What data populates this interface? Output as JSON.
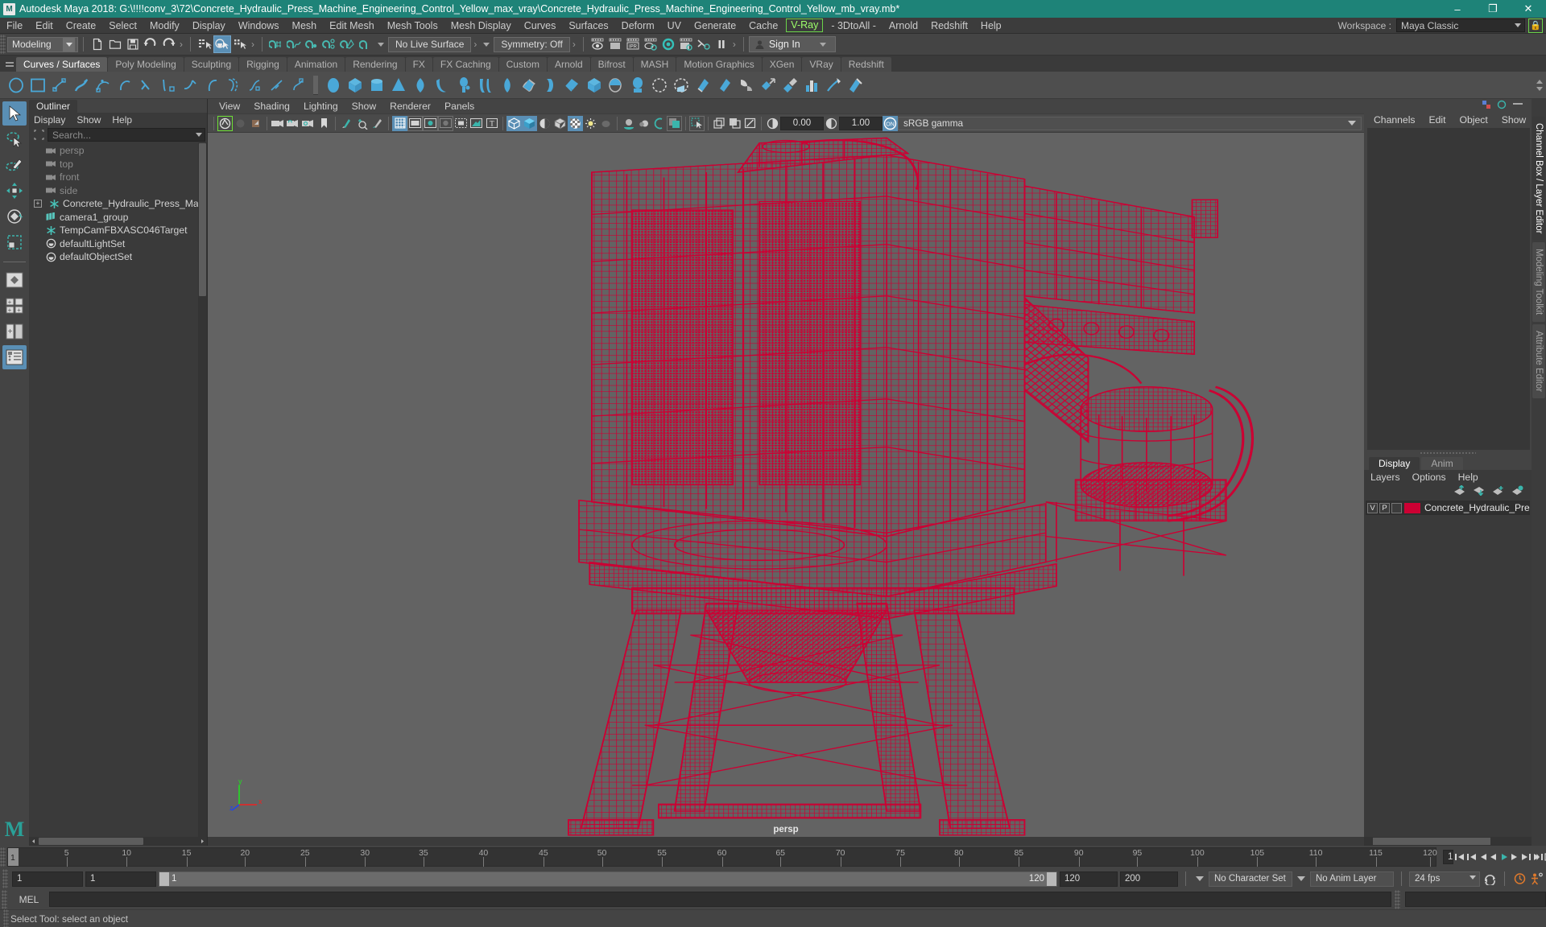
{
  "titlebar": {
    "app_icon": "maya-logo-icon",
    "title": "Autodesk Maya 2018: G:\\!!!!conv_3\\72\\Concrete_Hydraulic_Press_Machine_Engineering_Control_Yellow_max_vray\\Concrete_Hydraulic_Press_Machine_Engineering_Control_Yellow_mb_vray.mb*",
    "minimize": "–",
    "maximize": "❐",
    "close": "✕",
    "bg_color": "#1e8378"
  },
  "menubar": {
    "items": [
      "File",
      "Edit",
      "Create",
      "Select",
      "Modify",
      "Display",
      "Windows",
      "Mesh",
      "Edit Mesh",
      "Mesh Tools",
      "Mesh Display",
      "Curves",
      "Surfaces",
      "Deform",
      "UV",
      "Generate",
      "Cache"
    ],
    "vray_item": "V-Ray",
    "items_after": [
      "- 3DtoAll -",
      "Arnold",
      "Redshift",
      "Help"
    ],
    "workspace_label": "Workspace :",
    "workspace_value": "Maya Classic",
    "lock_icon": "lock-icon",
    "vray_color": "#9cff6a"
  },
  "toolbar": {
    "menuset_value": "Modeling",
    "file_icons": [
      "new-scene-icon",
      "open-scene-icon",
      "save-scene-icon",
      "undo-icon",
      "redo-icon"
    ],
    "select_mode_icons": [
      "select-by-hierarchy-icon",
      "select-by-object-type-icon",
      "select-by-component-type-icon"
    ],
    "snap_icons": [
      "snap-to-grid-icon",
      "snap-to-curve-icon",
      "snap-to-point-icon",
      "snap-to-projected-center-icon",
      "snap-to-view-plane-icon",
      "make-live-icon"
    ],
    "live_surface_value": "No Live Surface",
    "symmetry_value": "Symmetry: Off",
    "render_icons": [
      "render-current-frame-icon",
      "ipr-render-icon",
      "ipr-icon",
      "render-settings-icon",
      "hypershade-icon",
      "render-view-icon",
      "render-sequence-icon",
      "pause-render-icon"
    ],
    "signin_label": "Sign In",
    "signin_icon": "user-avatar-icon"
  },
  "shelf": {
    "tabs": [
      "Curves / Surfaces",
      "Poly Modeling",
      "Sculpting",
      "Rigging",
      "Animation",
      "Rendering",
      "FX",
      "FX Caching",
      "Custom",
      "Arnold",
      "Bifrost",
      "MASH",
      "Motion Graphics",
      "XGen",
      "VRay",
      "Redshift"
    ],
    "active_tab": "Curves / Surfaces",
    "icons": [
      "nurbs-circle-icon",
      "nurbs-square-icon",
      "add-points-tool-icon",
      "pencil-curve-tool-icon",
      "three-point-arc-icon",
      "two-point-arc-icon",
      "curve-editing-tool-icon",
      "attach-curves-icon",
      "detach-curves-icon",
      "insert-knot-icon",
      "offset-curve-icon",
      "cv-curve-tool-icon",
      "ep-curve-tool-icon",
      "bezier-curve-tool-icon",
      "rebuild-curve-icon",
      "nurbs-sphere-icon",
      "nurbs-cube-icon",
      "nurbs-cylinder-icon",
      "nurbs-cone-icon",
      "nurbs-plane-icon",
      "nurbs-torus-icon",
      "nurbs-circle-prim-icon",
      "nurbs-square-prim-icon",
      "revolve-icon",
      "loft-icon",
      "planar-icon",
      "extrude-icon",
      "birail-icon",
      "boundary-icon",
      "square-surface-icon",
      "bevel-icon",
      "bevel-plus-icon",
      "intersect-surfaces-icon",
      "project-curve-icon",
      "trim-tool-icon",
      "untrim-surfaces-icon",
      "attach-surfaces-icon",
      "detach-surfaces-icon",
      "align-surfaces-icon",
      "open-close-surfaces-icon",
      "surface-fillet-icon"
    ]
  },
  "tools_left": {
    "items": [
      "select-tool-icon",
      "lasso-select-tool-icon",
      "paint-select-tool-icon",
      "move-tool-icon",
      "rotate-tool-icon",
      "scale-tool-icon"
    ],
    "active": "select-tool-icon",
    "layout_items": [
      "single-perspective-view-icon",
      "four-view-layout-icon",
      "two-panes-side-icon",
      "outliner-persp-layout-icon"
    ],
    "active_layout": "outliner-persp-layout-icon",
    "logo": "M"
  },
  "outliner": {
    "tab": "Outliner",
    "menu": [
      "Display",
      "Show",
      "Help"
    ],
    "search_icon": "search-filter-icon",
    "search_placeholder": "Search...",
    "items": [
      {
        "label": "persp",
        "icon": "camera-icon",
        "dim": true,
        "expander": false
      },
      {
        "label": "top",
        "icon": "camera-icon",
        "dim": true,
        "expander": false
      },
      {
        "label": "front",
        "icon": "camera-icon",
        "dim": true,
        "expander": false
      },
      {
        "label": "side",
        "icon": "camera-icon",
        "dim": true,
        "expander": false
      },
      {
        "label": "Concrete_Hydraulic_Press_Machine_E",
        "icon": "transform-node-icon",
        "dim": false,
        "expander": true
      },
      {
        "label": "camera1_group",
        "icon": "group-node-icon",
        "dim": false,
        "expander": false
      },
      {
        "label": "TempCamFBXASC046Target",
        "icon": "transform-node-icon",
        "dim": false,
        "expander": false
      },
      {
        "label": "defaultLightSet",
        "icon": "set-node-icon",
        "dim": false,
        "expander": false
      },
      {
        "label": "defaultObjectSet",
        "icon": "set-node-icon",
        "dim": false,
        "expander": false
      }
    ]
  },
  "viewport": {
    "menu": [
      "View",
      "Shading",
      "Lighting",
      "Show",
      "Renderer",
      "Panels"
    ],
    "toolbar_icons": [
      "select-camera-icon",
      "camera-attributes-icon",
      "lock-camera-icon",
      "bookmark-icon",
      "image-plane-icon",
      "grid-icon",
      "film-gate-icon",
      "resolution-gate-icon",
      "gate-mask-icon",
      "film-origin-icon",
      "safe-action-icon",
      "xray-icon",
      "wireframe-on-shaded-icon",
      "smooth-shade-icon",
      "flat-shade-icon",
      "wireframe-icon",
      "textured-icon",
      "use-all-lights-icon",
      "shadows-icon",
      "screen-space-ao-icon",
      "motion-blur-icon",
      "multisample-icon",
      "depth-of-field-icon",
      "isolate-select-icon"
    ],
    "exposure_value": "0.00",
    "gamma_value": "1.00",
    "color_management_toggle": "ON",
    "color_profile": "sRGB gamma",
    "camera_label": "persp",
    "background_color": "#636363",
    "wireframe_color": "#cc0033",
    "axis": {
      "x": "x",
      "y": "y",
      "z": "z",
      "x_color": "#ee2222",
      "y_color": "#22dd22",
      "z_color": "#2244ee"
    }
  },
  "right_panel": {
    "menu": [
      "Channels",
      "Edit",
      "Object",
      "Show"
    ],
    "layer_tabs": [
      "Display",
      "Anim"
    ],
    "active_layer_tab": "Display",
    "layer_menu": [
      "Layers",
      "Options",
      "Help"
    ],
    "layer_buttons": [
      "move-layer-up-icon",
      "move-layer-down-icon",
      "new-layer-icon",
      "new-layer-from-selected-icon"
    ],
    "layers": [
      {
        "v": "V",
        "p": "P",
        "r": "",
        "color": "#cc0033",
        "name": "Concrete_Hydraulic_Press_Machine_E"
      }
    ],
    "vertical_tabs": [
      "Channel Box / Layer Editor",
      "Modeling Toolkit",
      "Attribute Editor"
    ],
    "active_vertical_tab": "Channel Box / Layer Editor"
  },
  "timeline": {
    "current_frame_marker": "1",
    "ticks": [
      5,
      10,
      15,
      20,
      25,
      30,
      35,
      40,
      45,
      50,
      55,
      60,
      65,
      70,
      75,
      80,
      85,
      90,
      95,
      100,
      105,
      110,
      115,
      120
    ],
    "frame_field": "1",
    "playback_icons": [
      "go-to-start-icon",
      "step-back-key-icon",
      "step-back-frame-icon",
      "play-backwards-icon",
      "play-forwards-icon",
      "step-forward-frame-icon",
      "step-forward-key-icon",
      "go-to-end-icon"
    ]
  },
  "range": {
    "start_field": "1",
    "anim_start_field": "1",
    "range_start": "1",
    "range_end": "120",
    "range_end_field": "120",
    "anim_end_field": "200",
    "character_set": "No Character Set",
    "anim_layer": "No Anim Layer",
    "fps": "24 fps",
    "loop_icon": "loop-playback-icon",
    "autokey_icon": "auto-keyframe-icon",
    "prefs_icon": "animation-preferences-icon"
  },
  "command_line": {
    "label": "MEL",
    "input_value": "",
    "input_placeholder": ""
  },
  "help_line": {
    "text": "Select Tool: select an object"
  }
}
